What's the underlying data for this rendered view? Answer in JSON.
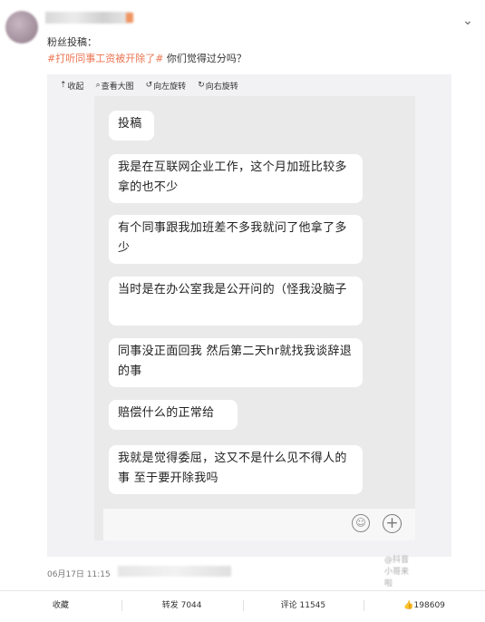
{
  "post": {
    "line1": "粉丝投稿：",
    "hashtag": "#打听同事工资被开除了#",
    "question": " 你们觉得过分吗？",
    "timestamp": "06月17日 11:15"
  },
  "toolbar": {
    "collapse": "收起",
    "view_large": "查看大图",
    "rotate_left": "向左旋转",
    "rotate_right": "向右旋转"
  },
  "icons": {
    "collapse": "collapse-icon",
    "view_large": "magnifier-icon",
    "rotate_left": "rotate-left-icon",
    "rotate_right": "rotate-right-icon",
    "emoji": "emoji-icon",
    "plus": "plus-icon",
    "chevron": "chevron-down-icon",
    "like": "thumbs-up-icon"
  },
  "chat": {
    "messages": [
      "投稿",
      "我是在互联网企业工作，这个月加班比较多拿的也不少",
      "有个同事跟我加班差不多我就问了他拿了多少",
      "当时是在办公室我是公开问的（怪我没脑子",
      "同事没正面回我 然后第二天hr就找我谈辞退的事",
      "赔偿什么的正常给",
      "我就是觉得委屈，这又不是什么见不得人的事 至于要开除我吗"
    ],
    "watermark": "@抖音小哥来啦"
  },
  "actions": {
    "favorite": "收藏",
    "repost": "转发 7044",
    "comment": "评论 11545",
    "like": "198609"
  },
  "colors": {
    "hashtag": "#eb7350",
    "chat_bg": "#eaeaea",
    "media_bg": "#f2f2f5"
  }
}
